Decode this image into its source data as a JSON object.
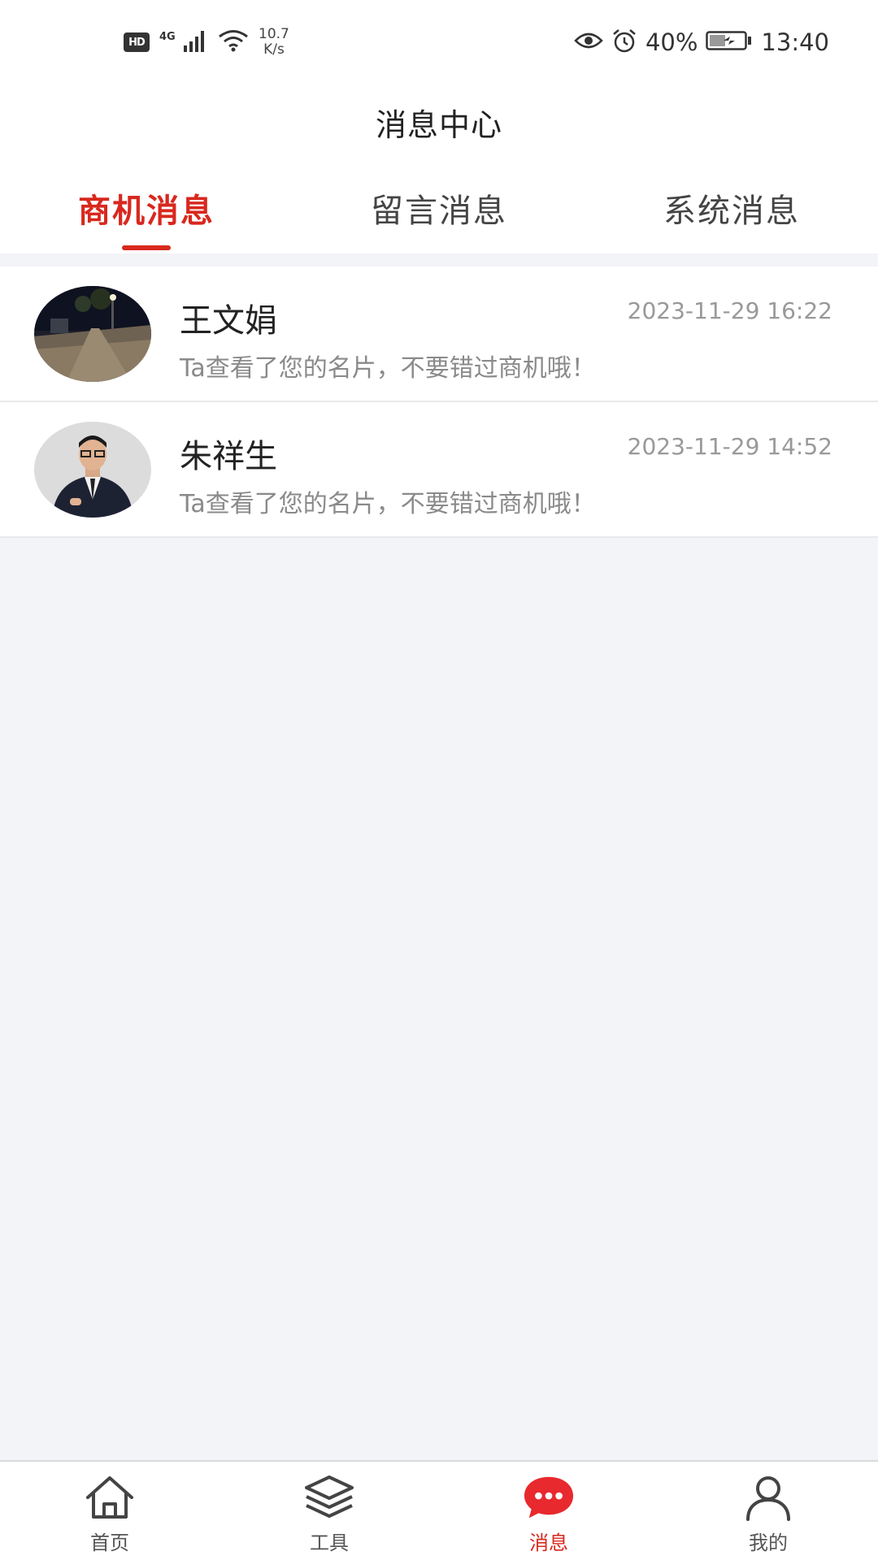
{
  "status_bar": {
    "hd": "HD",
    "network": "4G",
    "speed_value": "10.7",
    "speed_unit": "K/s",
    "battery": "40%",
    "time": "13:40"
  },
  "header": {
    "title": "消息中心"
  },
  "tabs": [
    {
      "label": "商机消息",
      "active": true
    },
    {
      "label": "留言消息",
      "active": false
    },
    {
      "label": "系统消息",
      "active": false
    }
  ],
  "messages": [
    {
      "name": "王文娟",
      "time": "2023-11-29 16:22",
      "preview": "Ta查看了您的名片，不要错过商机哦！",
      "avatar": "night-street-photo"
    },
    {
      "name": "朱祥生",
      "time": "2023-11-29 14:52",
      "preview": "Ta查看了您的名片，不要错过商机哦！",
      "avatar": "man-in-suit-photo"
    }
  ],
  "bottom_nav": [
    {
      "label": "首页",
      "icon": "home-icon",
      "active": false
    },
    {
      "label": "工具",
      "icon": "layers-icon",
      "active": false
    },
    {
      "label": "消息",
      "icon": "chat-bubble-icon",
      "active": true
    },
    {
      "label": "我的",
      "icon": "user-icon",
      "active": false
    }
  ],
  "colors": {
    "accent": "#d8281e",
    "background": "#f3f4f8",
    "muted_text": "#999999"
  }
}
